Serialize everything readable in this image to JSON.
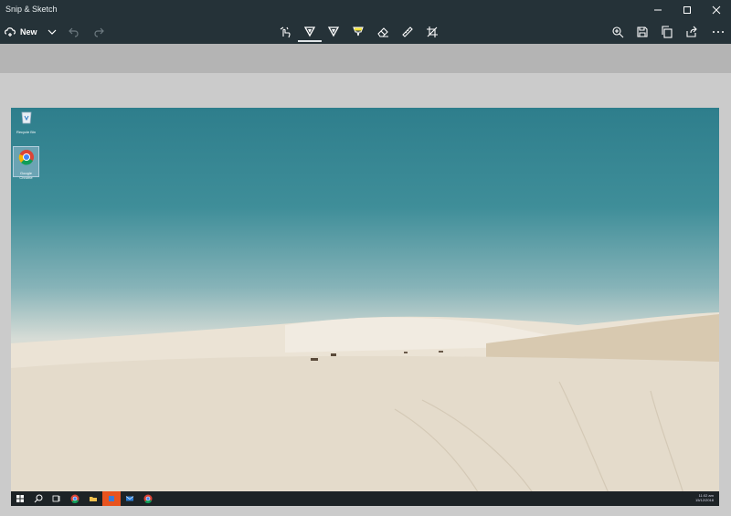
{
  "window": {
    "title": "Snip & Sketch"
  },
  "toolbar": {
    "new_label": "New",
    "icons": [
      "new-snip-icon",
      "chevron-down-icon",
      "undo-icon",
      "redo-icon",
      "touch-writing-icon",
      "ballpoint-pen-icon",
      "pencil-icon",
      "highlighter-icon",
      "eraser-icon",
      "ruler-icon",
      "crop-icon",
      "zoom-icon",
      "save-icon",
      "copy-icon",
      "share-icon",
      "more-icon"
    ],
    "active_tool": "ballpoint-pen",
    "highlighter_color": "#f3e33a"
  },
  "snip": {
    "desktop_icons": [
      {
        "label": "Recycle Bin",
        "icon": "recycle-bin-icon"
      },
      {
        "label": "Google Chrome",
        "icon": "chrome-icon"
      }
    ],
    "taskbar": {
      "icons": [
        "windows-start-icon",
        "search-icon",
        "task-view-icon",
        "chrome-icon",
        "file-explorer-icon",
        "app-icon",
        "mail-icon",
        "chrome-icon"
      ],
      "active_accent": "#e8531e",
      "clock_time": "11:02 am",
      "clock_date": "15/12/2018"
    }
  },
  "colors": {
    "chrome_bar": "#253238",
    "canvas_bg": "#cbcbcb",
    "band_bg": "#b4b4b4"
  }
}
